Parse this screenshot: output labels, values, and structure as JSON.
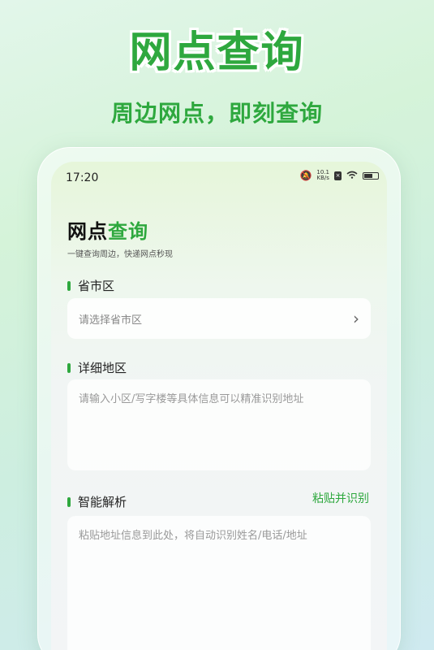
{
  "promo": {
    "title": "网点查询",
    "subtitle": "周边网点，即刻查询"
  },
  "status_bar": {
    "time": "17:20",
    "speed_value": "10.1",
    "speed_unit": "KB/s"
  },
  "page": {
    "title_part1": "网点",
    "title_part2": "查询",
    "description": "一键查询周边，快递网点秒现"
  },
  "region": {
    "label": "省市区",
    "placeholder": "请选择省市区"
  },
  "address": {
    "label": "详细地区",
    "placeholder": "请输入小区/写字楼等具体信息可以精准识别地址"
  },
  "smart_parse": {
    "label": "智能解析",
    "action": "粘贴并识别",
    "placeholder": "粘贴地址信息到此处，将自动识别姓名/电话/地址"
  },
  "colors": {
    "accent": "#2ea83e"
  }
}
